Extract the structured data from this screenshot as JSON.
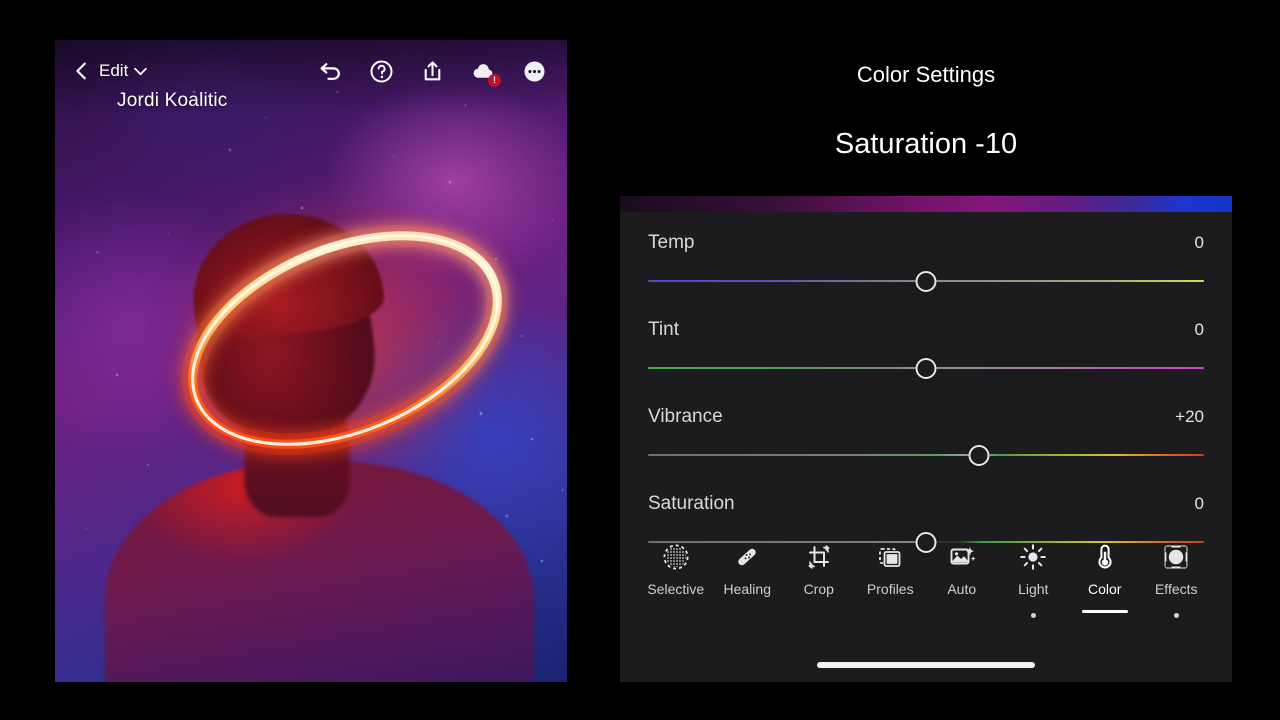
{
  "overlay": {
    "watermark": "Jordi Koalitic"
  },
  "editor_topbar": {
    "back_label": "Edit",
    "icons": [
      {
        "name": "undo-icon",
        "label": "Undo"
      },
      {
        "name": "help-icon",
        "label": "Help"
      },
      {
        "name": "share-icon",
        "label": "Share"
      },
      {
        "name": "cloud-sync-icon",
        "label": "Cloud",
        "badge": "!"
      },
      {
        "name": "more-options-icon",
        "label": "More"
      }
    ]
  },
  "annotations": {
    "title": "Color Settings",
    "subtitle": "Saturation -10"
  },
  "panel": {
    "sliders": [
      {
        "label": "Temp",
        "value": "0",
        "knob_percent": 50.0,
        "track_class": "t-temp"
      },
      {
        "label": "Tint",
        "value": "0",
        "knob_percent": 50.0,
        "track_class": "t-tint"
      },
      {
        "label": "Vibrance",
        "value": "+20",
        "knob_percent": 59.6,
        "track_class": "t-vib"
      },
      {
        "label": "Saturation",
        "value": "0",
        "knob_percent": 50.0,
        "track_class": "t-sat"
      }
    ],
    "toolbar": [
      {
        "label": "Selective",
        "icon": "selective-icon",
        "active": false,
        "indicator": "none"
      },
      {
        "label": "Healing",
        "icon": "healing-icon",
        "active": false,
        "indicator": "none"
      },
      {
        "label": "Crop",
        "icon": "crop-icon",
        "active": false,
        "indicator": "none"
      },
      {
        "label": "Profiles",
        "icon": "profiles-icon",
        "active": false,
        "indicator": "none"
      },
      {
        "label": "Auto",
        "icon": "auto-icon",
        "active": false,
        "indicator": "none"
      },
      {
        "label": "Light",
        "icon": "light-icon",
        "active": false,
        "indicator": "dot"
      },
      {
        "label": "Color",
        "icon": "color-icon",
        "active": true,
        "indicator": "underline"
      },
      {
        "label": "Effects",
        "icon": "effects-icon",
        "active": false,
        "indicator": "dot"
      }
    ]
  },
  "colors": {
    "background": "#000000",
    "panel_bg": "#1c1c1e",
    "text_primary": "#ffffff",
    "text_secondary": "#d8d8da",
    "accent_badge": "#c0102c"
  }
}
